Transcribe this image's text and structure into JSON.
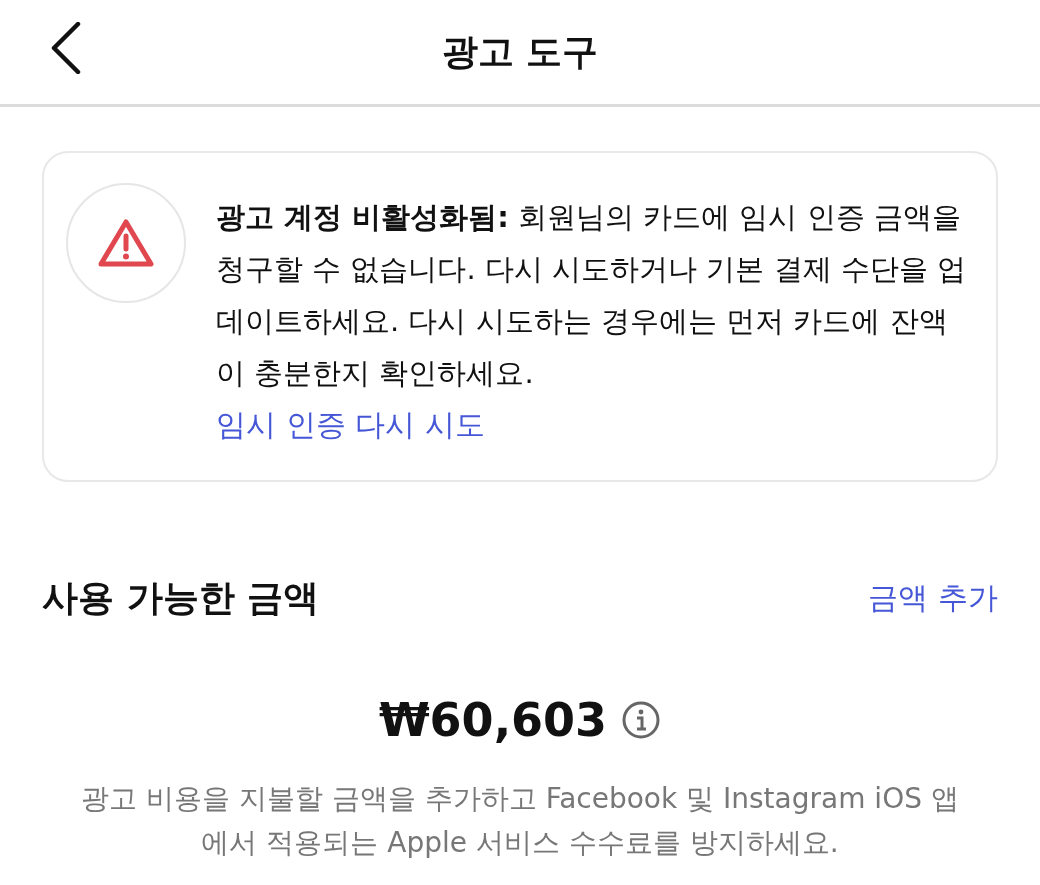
{
  "header": {
    "title": "광고 도구"
  },
  "alert": {
    "message": "**광고 계정 비활성화됨:** 회원님의 카드에 임시 인증 금액을 청구할 수 없습니다. 다시 시도하거나 기본 결제 수단을 업데이트하세요. 다시 시도하는 경우에는 먼저 카드에 잔액이 충분한지 확인하세요.",
    "link": "임시 인증 다시 시도"
  },
  "balance": {
    "title": "사용 가능한 금액",
    "add_link": "금액 추가",
    "amount": "₩60,603",
    "description": "광고 비용을 지불할 금액을 추가하고 Facebook 및 Instagram iOS 앱에서 적용되는 Apple 서비스 수수료를 방지하세요."
  }
}
